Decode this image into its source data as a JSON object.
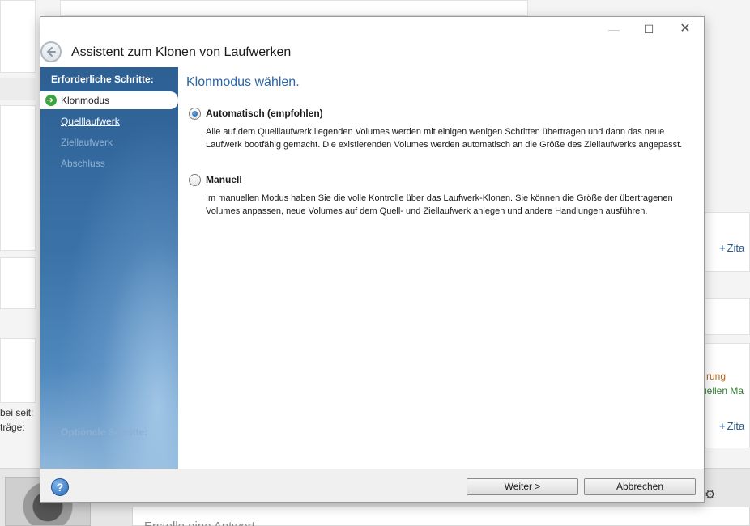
{
  "background": {
    "label_bei_seit": "bei seit:",
    "label_traege": "träge:",
    "link_zitat_1": "Zita",
    "link_zitat_2": "Zita",
    "text_rung": "rung",
    "text_uellen": "uellen Ma",
    "reply_placeholder": "Erstelle eine Antwort"
  },
  "window": {
    "title": "Assistent zum Klonen von Laufwerken",
    "minimize": "—",
    "maximize": "☐",
    "close": "✕"
  },
  "sidebar": {
    "heading": "Erforderliche Schritte:",
    "items": [
      {
        "label": "Klonmodus",
        "state": "active"
      },
      {
        "label": "Quelllaufwerk",
        "state": "link"
      },
      {
        "label": "Ziellaufwerk",
        "state": "disabled"
      },
      {
        "label": "Abschluss",
        "state": "disabled"
      }
    ],
    "optional_heading": "Optionale Schritte:"
  },
  "content": {
    "heading": "Klonmodus wählen.",
    "options": [
      {
        "label": "Automatisch (empfohlen)",
        "checked": true,
        "description": "Alle auf dem Quelllaufwerk liegenden Volumes werden mit einigen wenigen Schritten übertragen und dann das neue Laufwerk bootfähig gemacht. Die existierenden Volumes werden automatisch an die Größe des Ziellaufwerks angepasst."
      },
      {
        "label": "Manuell",
        "checked": false,
        "description": "Im manuellen Modus haben Sie die volle Kontrolle über das Laufwerk-Klonen. Sie können die Größe der übertragenen Volumes anpassen, neue Volumes auf dem Quell- und Ziellaufwerk anlegen und andere Handlungen ausführen."
      }
    ]
  },
  "footer": {
    "help_icon": "?",
    "next_label": "Weiter >",
    "cancel_label": "Abbrechen"
  },
  "colors": {
    "heading_blue": "#2a66a8",
    "sidebar_top": "#2d5f93",
    "sidebar_bottom": "#8fb7da"
  }
}
